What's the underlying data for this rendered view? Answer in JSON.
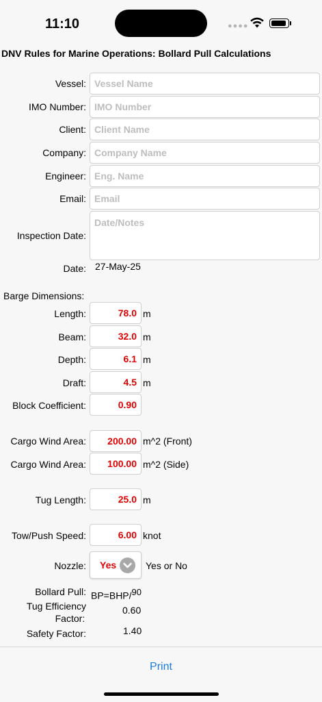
{
  "status": {
    "time": "11:10"
  },
  "title": "DNV Rules for Marine Operations: Bollard Pull Calculations",
  "fields": {
    "vessel": {
      "label": "Vessel:",
      "value": "",
      "placeholder": "Vessel Name"
    },
    "imo": {
      "label": "IMO Number:",
      "value": "",
      "placeholder": "IMO Number"
    },
    "client": {
      "label": "Client:",
      "value": "",
      "placeholder": "Client Name"
    },
    "company": {
      "label": "Company:",
      "value": "",
      "placeholder": "Company Name"
    },
    "engineer": {
      "label": "Engineer:",
      "value": "",
      "placeholder": "Eng. Name"
    },
    "email": {
      "label": "Email:",
      "value": "",
      "placeholder": "Email"
    },
    "inspection": {
      "label": "Inspection Date:",
      "value": "",
      "placeholder": "Date/Notes"
    },
    "date": {
      "label": "Date:",
      "value": "27-May-25"
    }
  },
  "barge": {
    "heading": "Barge Dimensions:",
    "length": {
      "label": "Length:",
      "value": "78.0",
      "unit": "m"
    },
    "beam": {
      "label": "Beam:",
      "value": "32.0",
      "unit": "m"
    },
    "depth": {
      "label": "Depth:",
      "value": "6.1",
      "unit": "m"
    },
    "draft": {
      "label": "Draft:",
      "value": "4.5",
      "unit": "m"
    },
    "block": {
      "label": "Block Coefficient:",
      "value": "0.90"
    }
  },
  "cargo": {
    "front": {
      "label": "Cargo Wind Area:",
      "value": "200.00",
      "unit": "m^2 (Front)"
    },
    "side": {
      "label": "Cargo Wind Area:",
      "value": "100.00",
      "unit": "m^2 (Side)"
    }
  },
  "tug": {
    "label": "Tug Length:",
    "value": "25.0",
    "unit": "m"
  },
  "speed": {
    "label": "Tow/Push Speed:",
    "value": "6.00",
    "unit": "knot"
  },
  "nozzle": {
    "label": "Nozzle:",
    "value": "Yes",
    "hint": "Yes or No"
  },
  "results": {
    "bollard": {
      "label": "Bollard Pull:",
      "formula": "BP=BHP/",
      "divisor": "90"
    },
    "efficiency": {
      "label_line1": "Tug Efficiency",
      "label_line2": "Factor:",
      "value": "0.60"
    },
    "safety": {
      "label": "Safety Factor:",
      "value": "1.40"
    }
  },
  "toolbar": {
    "print_label": "Print"
  },
  "colors": {
    "input_value": "#e10000",
    "link": "#1a7be0",
    "placeholder": "#bdbdbd"
  }
}
